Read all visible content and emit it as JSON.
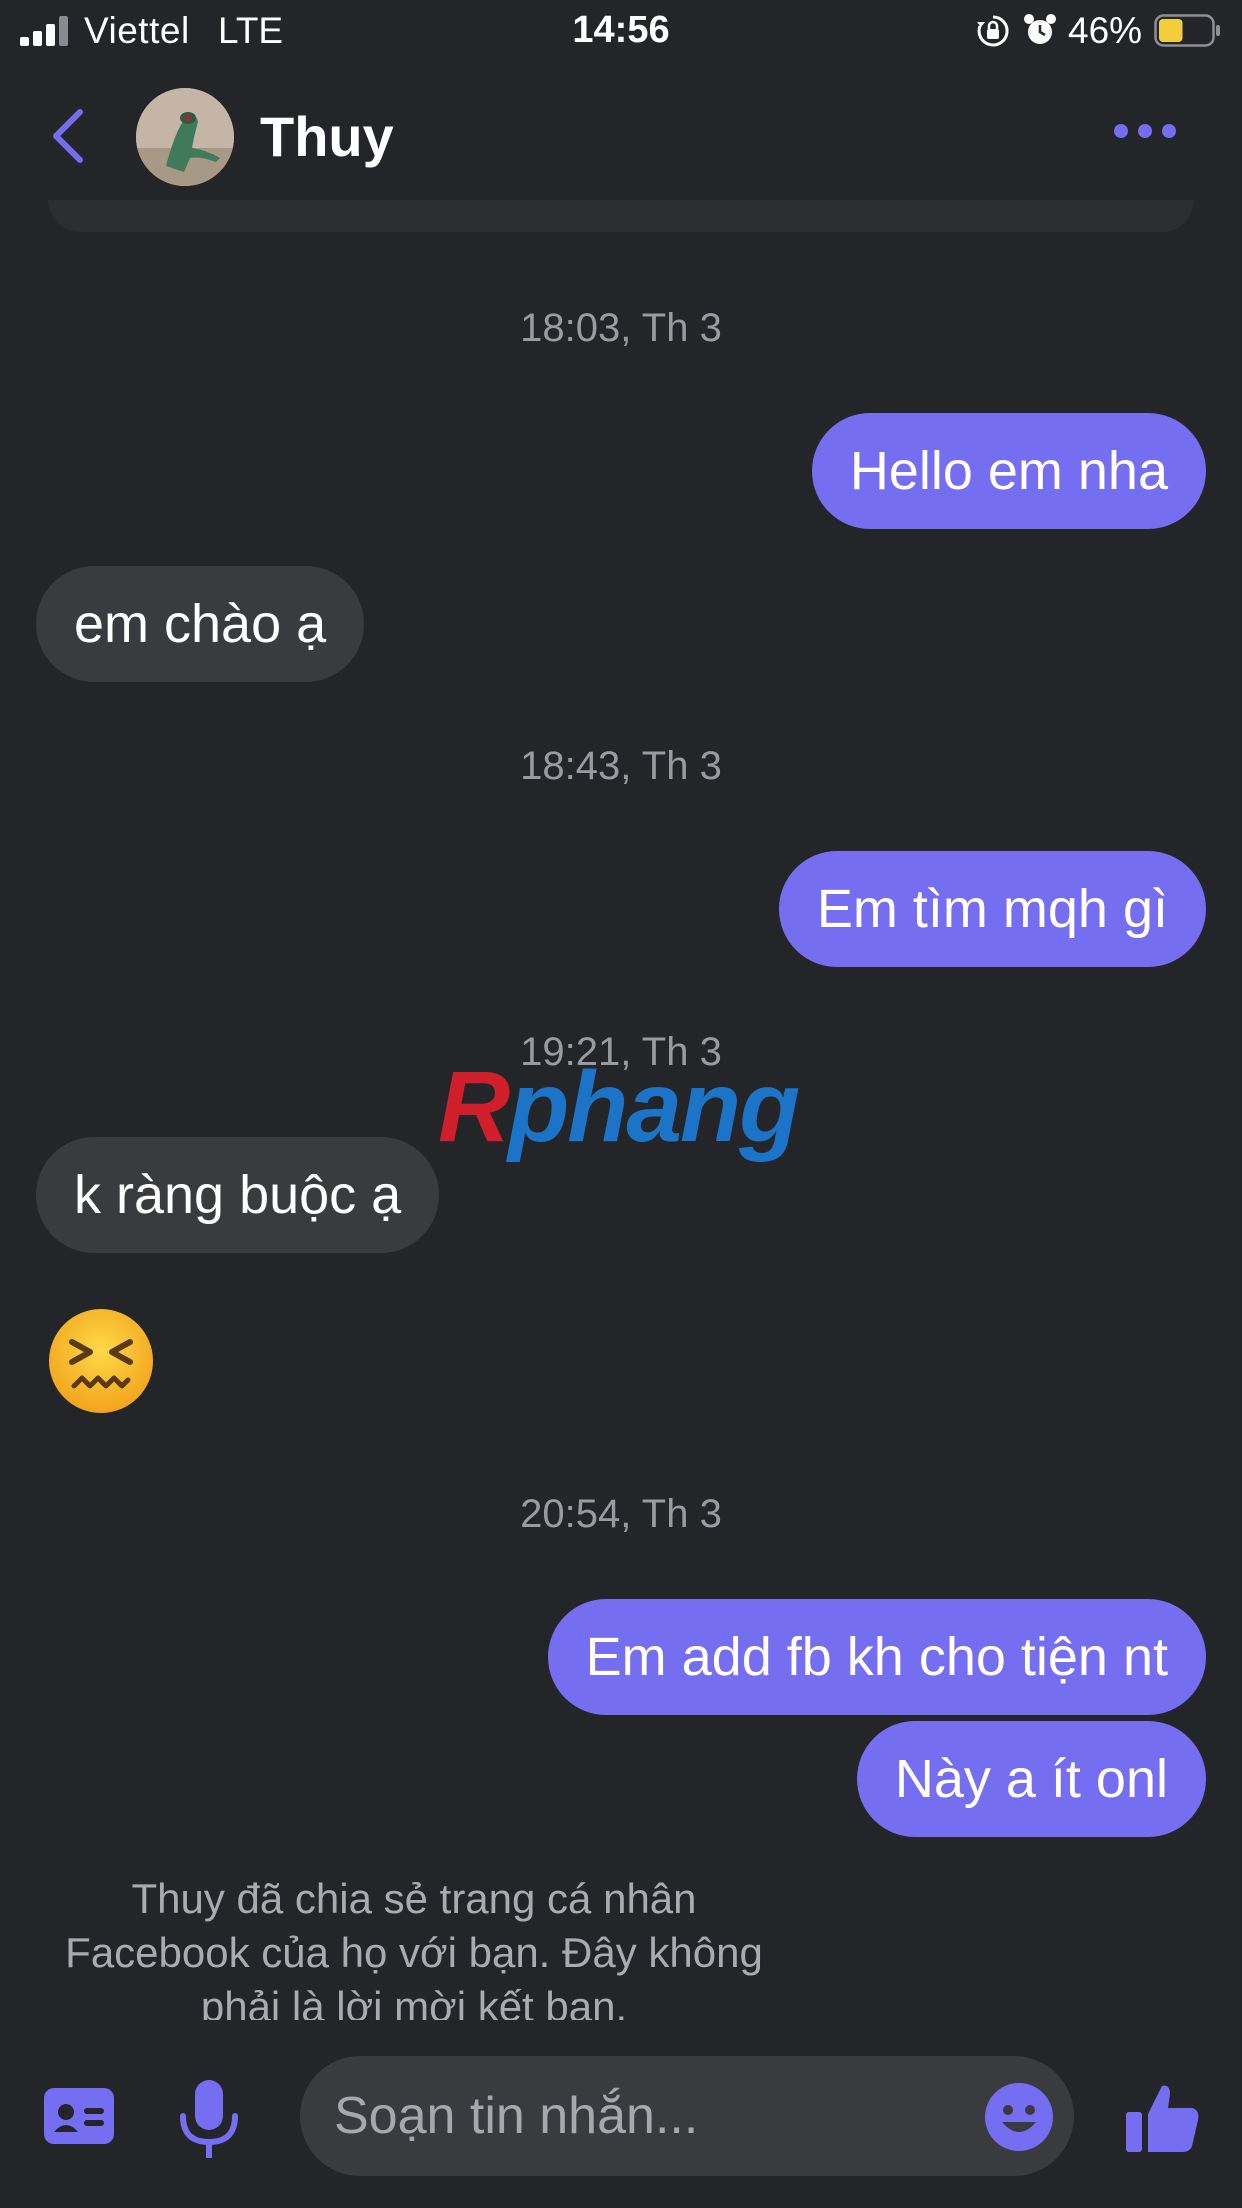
{
  "status": {
    "carrier": "Viettel",
    "network": "LTE",
    "time": "14:56",
    "battery": "46%",
    "battery_level": 0.46
  },
  "header": {
    "contact_name": "Thuy"
  },
  "conversation": {
    "timestamps": [
      "18:03, Th 3",
      "18:43, Th 3",
      "19:21, Th 3",
      "20:54, Th 3"
    ],
    "messages": [
      {
        "text": "Hello em nha",
        "direction": "outgoing"
      },
      {
        "text": "em chào ạ",
        "direction": "incoming"
      },
      {
        "text": "Em tìm mqh gì",
        "direction": "outgoing"
      },
      {
        "text": "k ràng buộc ạ",
        "direction": "incoming"
      },
      {
        "emoji": "confounded-face",
        "direction": "incoming"
      },
      {
        "text": "Em add fb kh cho tiện nt",
        "direction": "outgoing"
      },
      {
        "text": "Này a ít onl",
        "direction": "outgoing"
      }
    ],
    "system_note": "Thuy đã chia sẻ trang cá nhân Facebook của họ với bạn. Đây không phải là lời mời kết bạn."
  },
  "watermark": {
    "first_letter": "R",
    "rest": "phang"
  },
  "composer": {
    "placeholder": "Soạn tin nhắn..."
  },
  "colors": {
    "accent": "#766ef0",
    "background": "#242528",
    "incoming_bubble": "#3a3b3f",
    "timestamp": "#9a9ba0"
  }
}
